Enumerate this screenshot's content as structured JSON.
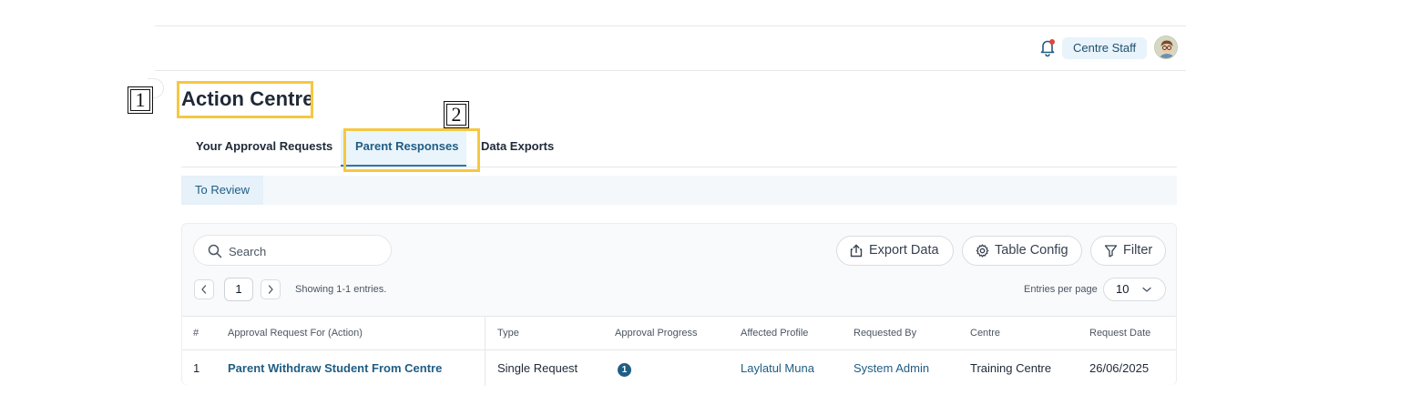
{
  "header": {
    "role_label": "Centre Staff"
  },
  "page": {
    "title": "Action Centre"
  },
  "annotations": {
    "one": "1",
    "two": "2"
  },
  "tabs": [
    {
      "label": "Your Approval Requests",
      "active": false
    },
    {
      "label": "Parent Responses",
      "active": true
    },
    {
      "label": "Data Exports",
      "active": false
    }
  ],
  "subtabs": [
    {
      "label": "To Review",
      "active": true
    }
  ],
  "toolbar": {
    "search_placeholder": "Search",
    "export_label": "Export Data",
    "config_label": "Table Config",
    "filter_label": "Filter"
  },
  "pagination": {
    "current_page": "1",
    "showing_text": "Showing 1-1 entries.",
    "entries_label": "Entries per page",
    "entries_value": "10"
  },
  "table": {
    "columns": [
      "#",
      "Approval Request For (Action)",
      "Type",
      "Approval Progress",
      "Affected Profile",
      "Requested By",
      "Centre",
      "Request Date"
    ],
    "rows": [
      {
        "index": "1",
        "action": "Parent Withdraw Student From Centre",
        "type": "Single Request",
        "progress": "1",
        "affected_profile": "Laylatul Muna",
        "requested_by": "System Admin",
        "centre": "Training Centre",
        "request_date": "26/06/2025"
      }
    ]
  },
  "colors": {
    "accent": "#1f5d84",
    "annotation": "#f5c842",
    "notification_dot": "#e0453a"
  }
}
